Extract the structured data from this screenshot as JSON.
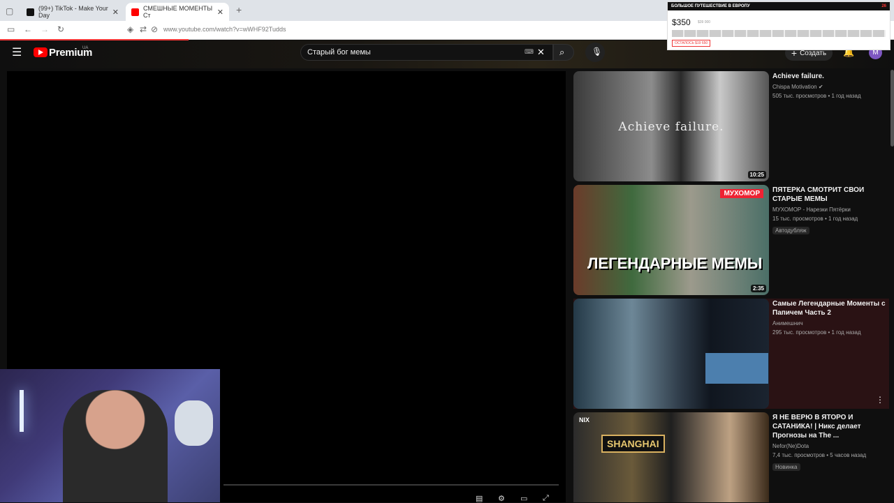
{
  "browser": {
    "tabs": [
      {
        "label": "(99+) TikTok - Make Your Day",
        "active": false
      },
      {
        "label": "СМЕШНЫЕ МОМЕНТЫ Ст",
        "active": true
      }
    ],
    "url": "www.youtube.com/watch?v=wWHF92Tudds"
  },
  "youtube": {
    "logo": "Premium",
    "region": "UA",
    "search": "Старый бог мемы",
    "create": "Создать",
    "avatar": "M"
  },
  "ad": {
    "title": "БОЛЬШОЕ ПУТЕШЕСТВИЕ В ЕВРОПУ",
    "counter": "26",
    "price": "$350",
    "old_price": "$39 000",
    "remaining": "ОСТАЛОСЬ $19 650"
  },
  "sidebar": [
    {
      "title": "Achieve failure.",
      "channel": "Chispa Motivation",
      "verified": true,
      "views": "505 тыс. просмотров • 1 год назад",
      "duration": "10:25",
      "thumb_caption": "Achieve failure."
    },
    {
      "title": "ПЯТЕРКА СМОТРИТ СВОИ СТАРЫЕ МЕМЫ",
      "channel": "МУХОМОР - Нарезки Пятёрки",
      "views": "15 тыс. просмотров • 1 год назад",
      "badge": "Автодубляж",
      "duration": "2:35",
      "thumb_caption": "ЛЕГЕНДАРНЫЕ МЕМЫ",
      "thumb_brand": "МУХОМОР"
    },
    {
      "title": "Самые Легендарные Моменты с Папичем Часть 2",
      "channel": "Анимешнич",
      "views": "295 тыс. просмотров • 1 год назад"
    },
    {
      "title": "Я НЕ ВЕРЮ В ЯТОРО И САТАНИКА! | Никс делает Прогнозы на The ...",
      "channel": "Nefor(Ne)Dota",
      "views": "7,4 тыс. просмотров • 5 часов назад",
      "badge": "Новинка",
      "thumb_caption": "SHANGHAI",
      "thumb_tag": "NIX"
    }
  ]
}
